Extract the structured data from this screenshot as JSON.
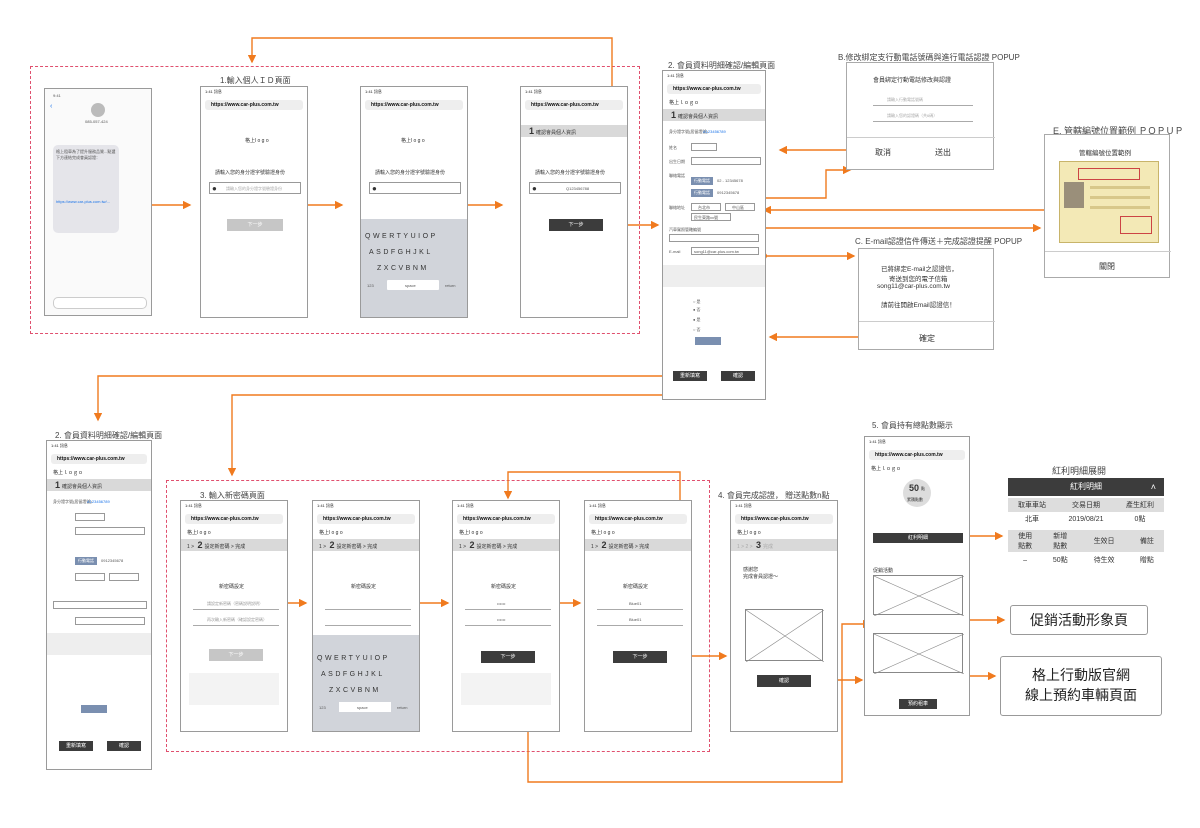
{
  "sections": {
    "s1": "1.輸入個人ＩＤ頁面",
    "s2a": "2. 會員資料明細確認/編輯頁面",
    "s2b": "2. 會員資料明細確認/編輯頁面",
    "s3": "3. 輸入新密碼頁面",
    "s4": "4. 會員完成認證， 贈送點數n點",
    "s5": "5. 會員持有總點數顯示",
    "popB": "B.修改綁定支行動電話號碼與進行電話認證 POPUP",
    "popC": "C. E-mail認證信件傳送＋完成認證提醒 POPUP",
    "popE": "E. 管轄編號位置範例 ＰＯＰＵＰ",
    "bonusTitle": "紅利明細展開"
  },
  "phone": {
    "url": "https://www.car-plus.com.tw",
    "status": "1:41\n訊息",
    "logo": "格上l o g o",
    "logo2": "格上ｌｏｇｏ",
    "idPrompt": "請輸入您的身分證字號驗證身份",
    "idPlaceholder": "請輸入您的身分證字號驗證身份",
    "idValue": "Q123456788",
    "next": "下一步",
    "step1": "確認會員個人資訊",
    "step2": "設定新密碼",
    "step3": "完成",
    "setPw": "新密碼設定",
    "pwPh1": "請設定新密碼（密碼說明說明）",
    "pwPh2": "再次輸入新密碼（確認設定密碼）",
    "pwMask": "••••••",
    "pwVal": "Blue01",
    "space": "space",
    "return": "return",
    "n123": "123",
    "thanks": "感謝您\n完成會員認證～",
    "ok": "確認",
    "bonusBtn": "紅利明細",
    "activity": "促銷活動",
    "bookBtn": "預約租車",
    "resetBtn": "重新填寫",
    "confirmBtn": "確認",
    "idNoLabel": "身分證字號(居留證號)",
    "idNo": "A123456789",
    "nameLabel": "姓名",
    "bdayLabel": "出生日期",
    "phoneLabel": "聯絡電話",
    "mobile1": "02 - 12345678",
    "mobileBtn": "行動電話",
    "mobile2": "0912345678",
    "addrLabel": "聯絡地址",
    "city": "台北市",
    "dist": "中山區",
    "street": "民生東路xx號",
    "licLabel": "汽車駕照管轄編號",
    "email": "song11@car-plus.com.tw",
    "emailLabel": "E-mail",
    "pointsCircle": "50",
    "pointsUnit": "點",
    "pointsSub": "累積點數"
  },
  "sms": {
    "sender": "085-057-424",
    "body": "格上租車為了提升服務品質...點選下方連結完成會員認證：",
    "link": "https://www.car-plus.com.tw/..."
  },
  "popupB": {
    "title": "會員綁定行動電話修改與認證",
    "field1": "請輸入行動電話號碼",
    "field2": "請輸入您的認證碼（共6碼）",
    "cancel": "取消",
    "send": "送出"
  },
  "popupC": {
    "line1": "已將綁定E-mail之認證信，",
    "line2": "寄送到您的電子信箱",
    "line3": "song11@car-plus.com.tw",
    "line4": "請前往開啟Email認證信！",
    "ok": "確定"
  },
  "popupE": {
    "title": "管轄編號位置範例",
    "close": "關閉"
  },
  "callouts": {
    "promo": "促銷活動形象頁",
    "web1": "格上行動版官網",
    "web2": "線上預約車輛頁面"
  },
  "bonusTable": {
    "title": "紅利明細",
    "headers": [
      "取車車站",
      "交易日期",
      "產生紅利"
    ],
    "row1": [
      "北車",
      "2019/08/21",
      "0點"
    ],
    "headers2": [
      "使用\n點數",
      "新增\n點數",
      "生效日",
      "備註"
    ],
    "row2": [
      "–",
      "50點",
      "待生效",
      "贈點"
    ]
  },
  "colors": {
    "arrow": "#f07a1e",
    "dashed": "#e0506e",
    "dark": "#3c3c3c"
  }
}
